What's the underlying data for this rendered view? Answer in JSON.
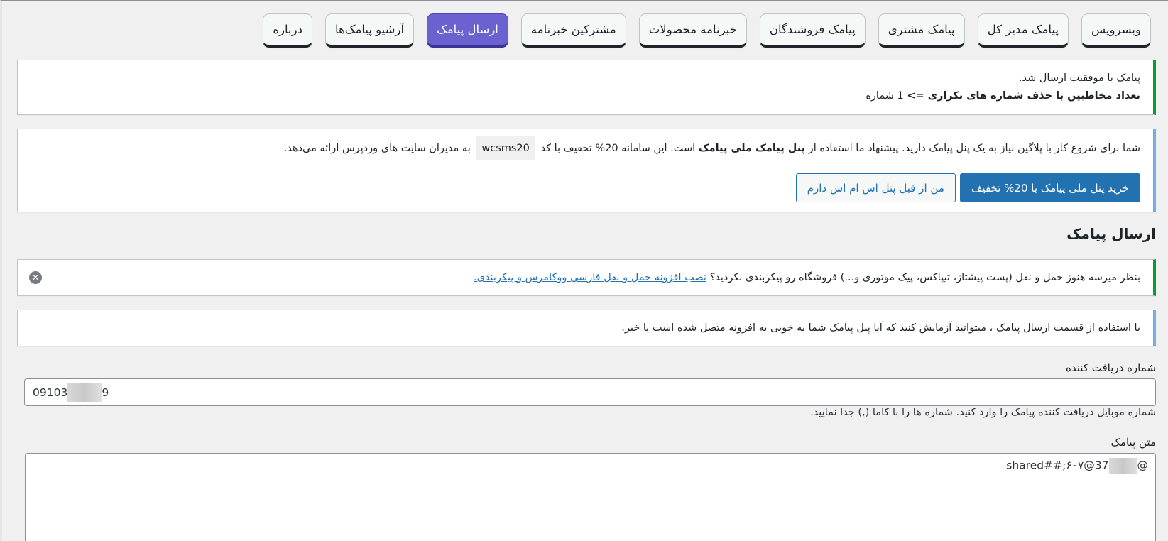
{
  "tabs": [
    {
      "label": "وبسرویس",
      "active": false
    },
    {
      "label": "پیامک مدیر کل",
      "active": false
    },
    {
      "label": "پیامک مشتری",
      "active": false
    },
    {
      "label": "پیامک فروشندگان",
      "active": false
    },
    {
      "label": "خبرنامه محصولات",
      "active": false
    },
    {
      "label": "مشترکین خبرنامه",
      "active": false
    },
    {
      "label": "ارسال پیامک",
      "active": true
    },
    {
      "label": "آرشیو پیامک‌ها",
      "active": false
    },
    {
      "label": "درباره",
      "active": false
    }
  ],
  "success_notice": {
    "line1": "پیامک با موفقیت ارسال شد.",
    "line2_bold": "تعداد مخاطبین با حذف شماره های تکراری =>",
    "line2_rest": " 1 شماره"
  },
  "panel_notice": {
    "text_part1": "شما برای شروع کار با پلاگین نیاز به یک پنل پیامک دارید. پیشنهاد ما استفاده از ",
    "text_bold": "پنل پیامک ملی پیامک",
    "text_part2": " است. این سامانه 20% تخفیف با کد",
    "code": "wcsms20",
    "text_part3": "به مدیران سایت های وردپرس ارائه می‌دهد.",
    "buy_button": "خرید پنل ملی پیامک با 20% تخفیف",
    "have_button": "من از قبل پنل اس ام اس دارم"
  },
  "section_title": "ارسال پیامک",
  "shipping_notice": {
    "text": "بنظر میرسه هنوز حمل و نقل (پست پیشتاز، تیپاکس، پیک موتوری و...) فروشگاه رو پیکربندی نکردید؟ ",
    "link": "نصب افزونه حمل و نقل فارسی ووکامرس و پیکربندی.",
    "dismiss_icon": "close-circle-icon"
  },
  "test_notice": {
    "text": "با استفاده از قسمت ارسال پیامک ، میتوانید آزمایش کنید که آیا پنل پیامک شما به خوبی به افزونه متصل شده است یا خیر."
  },
  "receiver": {
    "label": "شماره دریافت کننده",
    "value_start": "09103",
    "value_end": "9",
    "description": "شماره موبایل دریافت کننده پیامک را وارد کنید. شماره ها را با کاما (,) جدا نمایید."
  },
  "message": {
    "label": "متن پیامک",
    "value_start": "shared##;۶۰۷@37",
    "value_end": "@"
  },
  "colors": {
    "active_tab": "#6b61d0",
    "primary_button": "#2271b1",
    "success_border": "#00a32a",
    "info_border": "#72aee6"
  }
}
